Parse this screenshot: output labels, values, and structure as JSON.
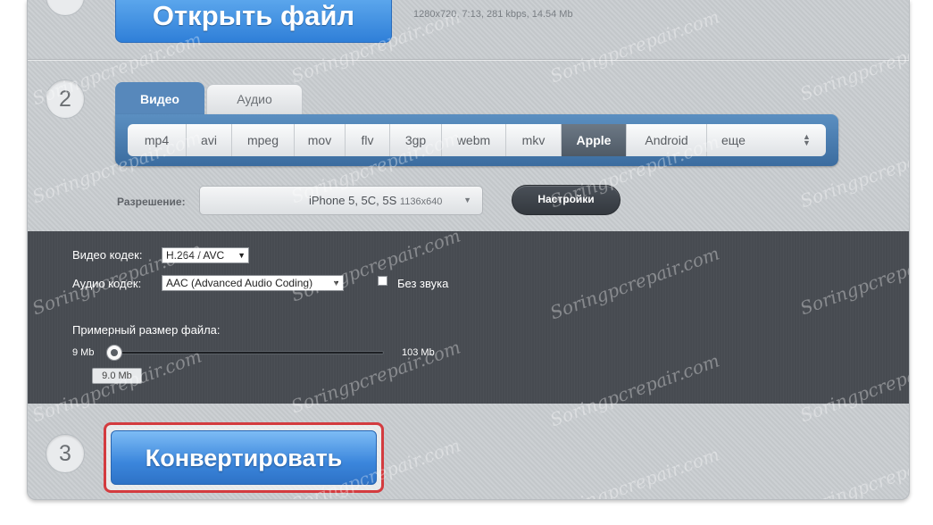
{
  "step1": {
    "open_file_label": "Открыть файл",
    "file_info": "1280x720, 7:13, 281 kbps, 14.54 Mb"
  },
  "step2": {
    "number": "2",
    "tabs": [
      {
        "label": "Видео",
        "active": true
      },
      {
        "label": "Аудио",
        "active": false
      }
    ],
    "formats": [
      {
        "label": "mp4",
        "active": false
      },
      {
        "label": "avi",
        "active": false
      },
      {
        "label": "mpeg",
        "active": false
      },
      {
        "label": "mov",
        "active": false
      },
      {
        "label": "flv",
        "active": false
      },
      {
        "label": "3gp",
        "active": false
      },
      {
        "label": "webm",
        "active": false
      },
      {
        "label": "mkv",
        "active": false
      },
      {
        "label": "Apple",
        "active": true
      },
      {
        "label": "Android",
        "active": false
      },
      {
        "label": "еще",
        "active": false
      }
    ],
    "resolution_label": "Разрешение:",
    "resolution_value": "iPhone 5, 5C, 5S",
    "resolution_size": "1136x640",
    "settings_label": "Настройки"
  },
  "settings": {
    "video_codec_label": "Видео кодек:",
    "video_codec_value": "H.264 / AVC",
    "audio_codec_label": "Аудио кодек:",
    "audio_codec_value": "AAC (Advanced Audio Coding)",
    "mute_label": "Без звука",
    "mute_checked": false,
    "size_label": "Примерный размер файла:",
    "size_min": "9 Mb",
    "size_max": "103 Mb",
    "size_current": "9.0 Mb"
  },
  "step3": {
    "number": "3",
    "convert_label": "Конвертировать"
  },
  "watermark": "Soringpcrepair.com",
  "colors": {
    "accent_blue": "#3b86dc",
    "panel_blue": "#4a7cae",
    "dark_section": "#474b51",
    "highlight_red": "#d33b3f"
  }
}
